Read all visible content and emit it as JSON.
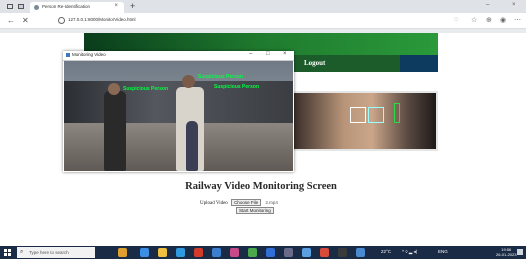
{
  "browser": {
    "tab_title": "Person Re-Identification",
    "tab_close": "×",
    "new_tab": "+",
    "url": "127.0.0.1:8000/MonitorVideo.html",
    "win_min": "–",
    "win_close": "×"
  },
  "site": {
    "logout_label": "Logout",
    "main_title": "Railway Video Monitoring Screen",
    "upload_label": "Upload Video",
    "choose_file_label": "Choose File",
    "file_name": "2.mp4",
    "start_button": "Start Monitoring"
  },
  "video_window": {
    "title": "Monitoring Video",
    "btn_min": "–",
    "btn_max": "□",
    "btn_close": "×",
    "detection_1": "Suspicious Person",
    "detection_2": "Suspicious Person",
    "detection_3": "Suspicious Person"
  },
  "taskbar": {
    "search_placeholder": "Type here to search",
    "weather": "22°C",
    "lang": "ENG",
    "time": "19:56",
    "date": "26-01-2023"
  },
  "colors": {
    "banner_dark": "#0a3d1c",
    "banner_light": "#2a9a3a",
    "navbar": "#1c5b2a",
    "detection_text": "#00ff40",
    "taskbar": "#1a2b46"
  }
}
